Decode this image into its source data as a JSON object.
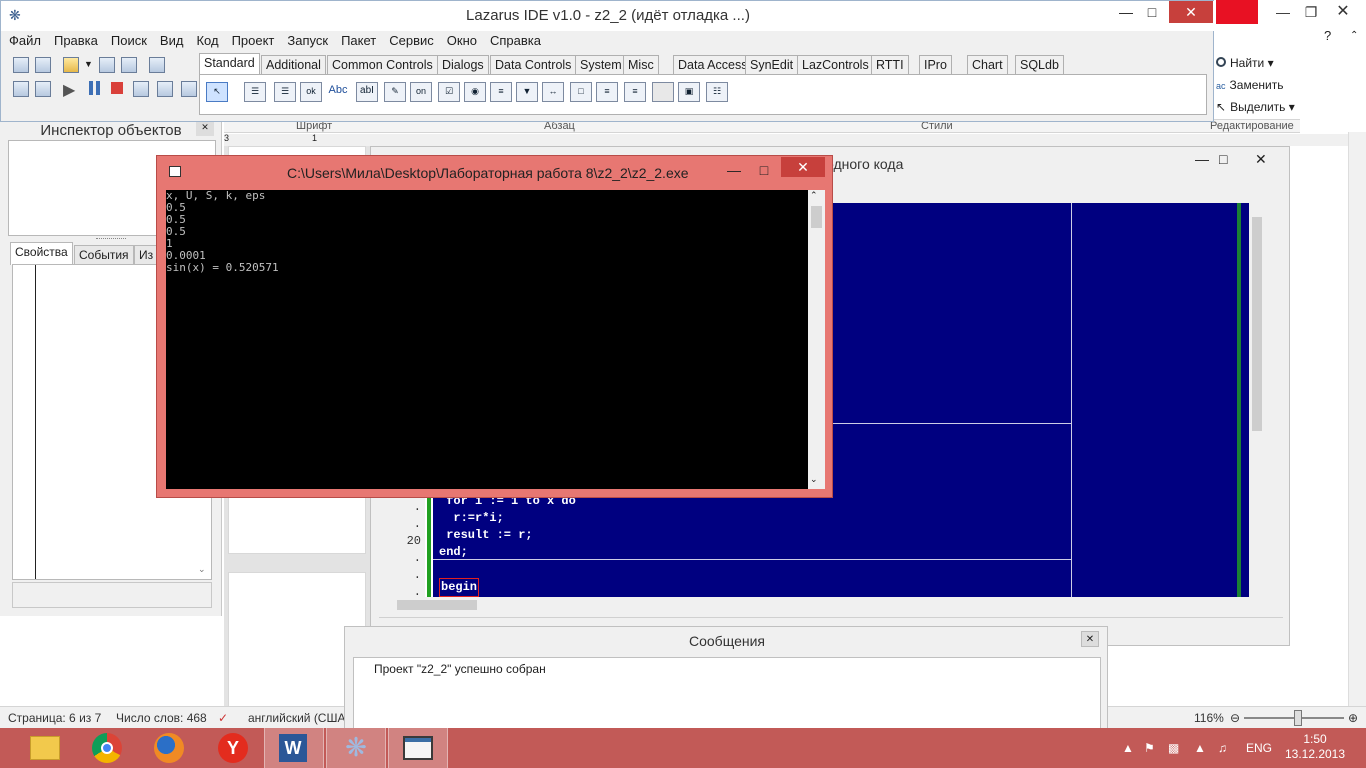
{
  "lazarus": {
    "title": "Lazarus IDE v1.0 - z2_2 (идёт отладка ...)",
    "menu": [
      "Файл",
      "Правка",
      "Поиск",
      "Вид",
      "Код",
      "Проект",
      "Запуск",
      "Пакет",
      "Сервис",
      "Окно",
      "Справка"
    ],
    "palette_tabs": [
      "Standard",
      "Additional",
      "Common Controls",
      "Dialogs",
      "Data Controls",
      "System",
      "Misc",
      "Data Access",
      "SynEdit",
      "LazControls",
      "RTTI",
      "IPro",
      "Chart",
      "SQLdb"
    ],
    "palette_active": "Standard",
    "component_icons": [
      "ok",
      "Abc",
      "abI",
      "on"
    ]
  },
  "inspector": {
    "title": "Инспектор объектов",
    "tabs": [
      "Свойства",
      "События",
      "Из"
    ]
  },
  "word": {
    "ribbon_items": [
      "Найти",
      "Заменить",
      "Выделить"
    ],
    "group_labels": [
      "Шрифт",
      "Абзац",
      "Стили",
      "Редактирование"
    ],
    "ruler_marks": [
      "3",
      "1"
    ],
    "status": {
      "page": "Страница: 6 из 7",
      "words": "Число слов: 468",
      "language": "английский (США",
      "zoom": "116%"
    }
  },
  "source_editor": {
    "title_fragment": "одного кода",
    "gutter": [
      ".",
      ".",
      "20",
      ".",
      ".",
      "."
    ],
    "code_lines": [
      " for i := 1 to x do",
      "  r:=r*i;",
      " result := r;",
      "end;",
      "",
      "begin"
    ]
  },
  "console": {
    "title": "C:\\Users\\Мила\\Desktop\\Лабораторная работа 8\\z2_2\\z2_2.exe",
    "lines": [
      "x, U, S, k, eps",
      "0.5",
      "0.5",
      "0.5",
      "1",
      "0.0001",
      "sin(x) = 0.520571"
    ]
  },
  "messages": {
    "title": "Сообщения",
    "items": [
      "Проект \"z2_2\" успешно собран"
    ]
  },
  "taskbar": {
    "language": "ENG",
    "time": "1:50",
    "date": "13.12.2013"
  },
  "colors": {
    "console_frame": "#e77772",
    "taskbar": "#c25a57",
    "editor_bg": "#000080"
  }
}
